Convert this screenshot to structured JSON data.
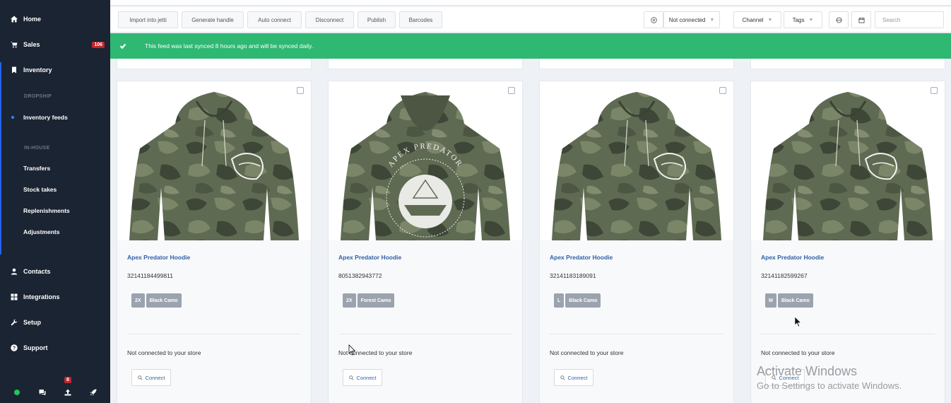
{
  "sidebar": {
    "items": [
      {
        "label": "Home",
        "icon": "home-icon"
      },
      {
        "label": "Sales",
        "icon": "cart-icon",
        "badge": "106"
      },
      {
        "label": "Inventory",
        "icon": "bookmark-icon"
      },
      {
        "label": "Contacts",
        "icon": "user-icon"
      },
      {
        "label": "Integrations",
        "icon": "grid-icon"
      },
      {
        "label": "Setup",
        "icon": "wrench-icon"
      },
      {
        "label": "Support",
        "icon": "help-icon"
      }
    ],
    "sections": {
      "dropship": "DROPSHIP",
      "inhouse": "IN-HOUSE"
    },
    "sub_items": {
      "inventory_feeds": "Inventory feeds",
      "transfers": "Transfers",
      "stock_takes": "Stock takes",
      "replenishments": "Replenishments",
      "adjustments": "Adjustments"
    },
    "bottom": {
      "notification_count": "8"
    },
    "active_color": "#2563eb"
  },
  "toolbar": {
    "buttons": [
      "Import into jetti",
      "Generate handle",
      "Auto connect",
      "Disconnect",
      "Publish",
      "Barcodes"
    ],
    "filter_status": "Not connected",
    "filter_channel": "Channel",
    "filter_tags": "Tags",
    "search_placeholder": "Search"
  },
  "banner": {
    "text": "This feed was last synced 8 hours ago and will be synced daily.",
    "color": "#2eb872"
  },
  "products": [
    {
      "title": "Apex Predator Hoodie",
      "sku": "32141184499811",
      "size": "2X",
      "color": "Black Camo",
      "status": "Not connected to your store",
      "action": "Connect",
      "design": "front"
    },
    {
      "title": "Apex Predator Hoodie",
      "sku": "8051382943772",
      "size": "2X",
      "color": "Forest Camo",
      "status": "Not connected to your store",
      "action": "Connect",
      "design": "back"
    },
    {
      "title": "Apex Predator Hoodie",
      "sku": "32141183189091",
      "size": "L",
      "color": "Black Camo",
      "status": "Not connected to your store",
      "action": "Connect",
      "design": "front"
    },
    {
      "title": "Apex Predator Hoodie",
      "sku": "32141182599267",
      "size": "M",
      "color": "Black Camo",
      "status": "Not connected to your store",
      "action": "Connect",
      "design": "front"
    }
  ],
  "back_print_text": "APEX PREDATOR",
  "watermark": {
    "line1": "Activate Windows",
    "line2": "Go to Settings to activate Windows."
  }
}
